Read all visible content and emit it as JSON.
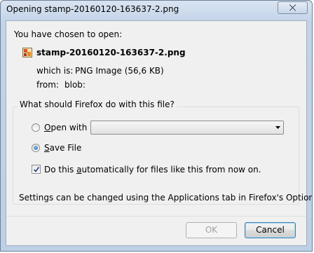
{
  "window": {
    "title": "Opening stamp-20160120-163637-2.png"
  },
  "dialog": {
    "intro": "You have chosen to open:",
    "file_name": "stamp-20160120-163637-2.png",
    "which_is_label": "which is:",
    "which_is_value": "PNG Image (56,6 KB)",
    "from_label": "from:",
    "from_value": "blob:",
    "question": "What should Firefox do with this file?",
    "open_with": {
      "access_key": "O",
      "label_rest": "pen with",
      "selected": false,
      "dropdown_value": ""
    },
    "save_file": {
      "access_key": "S",
      "label_rest": "ave File",
      "selected": true
    },
    "auto": {
      "label_before": "Do this ",
      "access_key": "a",
      "label_after": "utomatically for files like this from now on.",
      "checked": true
    },
    "settings_note": "Settings can be changed using the Applications tab in Firefox's Options."
  },
  "buttons": {
    "ok": "OK",
    "cancel": "Cancel"
  },
  "colors": {
    "title_bar": "#c3d4e8",
    "dialog_bg": "#f0f0f0",
    "default_button_border": "#3c7fb1"
  }
}
